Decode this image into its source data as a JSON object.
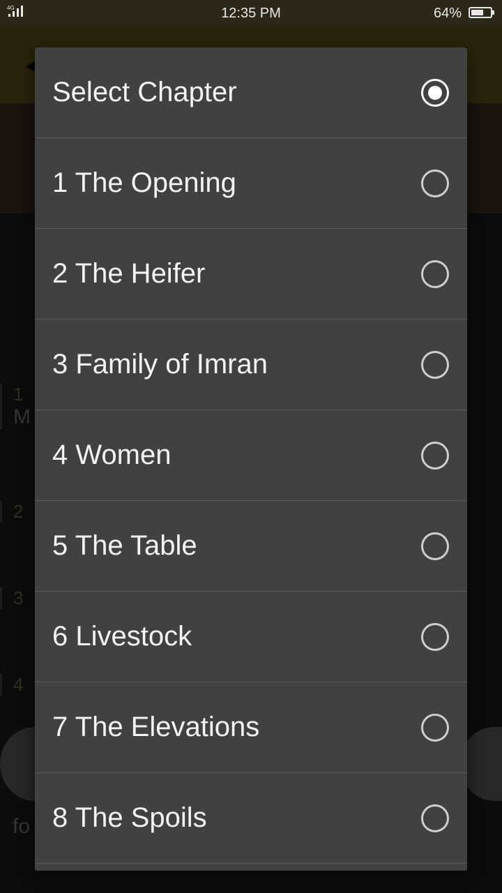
{
  "status_bar": {
    "network": "4G",
    "time": "12:35 PM",
    "battery": "64%",
    "battery_level": 0.64
  },
  "background_list": {
    "items": [
      {
        "number": "1",
        "text": "M"
      },
      {
        "number": "2",
        "text": ""
      },
      {
        "number": "3",
        "text": ""
      },
      {
        "number": "4",
        "text": ""
      }
    ],
    "footer_fragment": "fo"
  },
  "dialog": {
    "options": [
      {
        "label": "Select Chapter",
        "selected": true
      },
      {
        "label": "1 The Opening",
        "selected": false
      },
      {
        "label": "2 The Heifer",
        "selected": false
      },
      {
        "label": "3 Family of Imran",
        "selected": false
      },
      {
        "label": "4 Women",
        "selected": false
      },
      {
        "label": "5 The Table",
        "selected": false
      },
      {
        "label": "6 Livestock",
        "selected": false
      },
      {
        "label": "7 The Elevations",
        "selected": false
      },
      {
        "label": "8 The Spoils",
        "selected": false
      }
    ]
  },
  "icons": {
    "back": "arrow-left-icon",
    "overflow": "more-vert-icon",
    "signal": "signal-icon",
    "battery": "battery-icon"
  },
  "colors": {
    "toolbar": "#5e511c",
    "dialog_bg": "#414141",
    "radio_selected": "#ffffff"
  }
}
